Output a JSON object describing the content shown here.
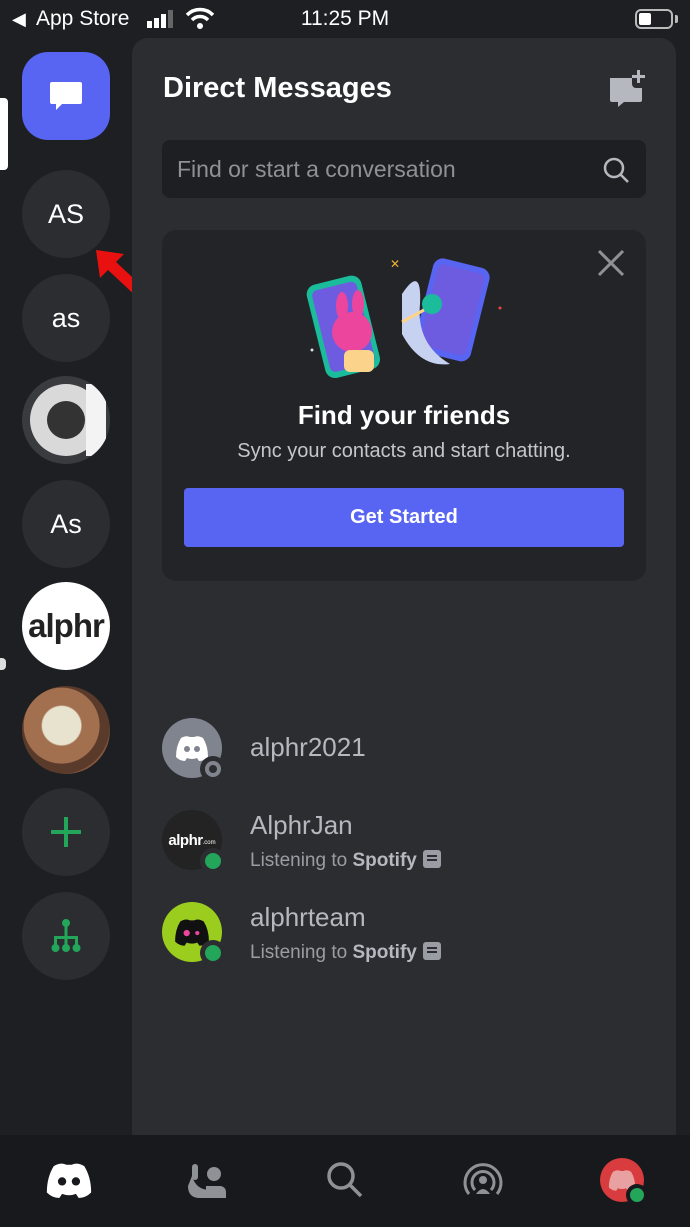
{
  "statusbar": {
    "back_label": "App Store",
    "time": "11:25 PM"
  },
  "rail": {
    "items": [
      {
        "label": "AS"
      },
      {
        "label": "as"
      },
      {
        "label": ""
      },
      {
        "label": "As"
      },
      {
        "label": "alphr"
      },
      {
        "label": ""
      },
      {
        "label": "+"
      },
      {
        "label": ""
      }
    ]
  },
  "header": {
    "title": "Direct Messages"
  },
  "search": {
    "placeholder": "Find or start a conversation"
  },
  "card": {
    "title": "Find your friends",
    "subtitle": "Sync your contacts and start chatting.",
    "button_label": "Get Started"
  },
  "dms": [
    {
      "name": "alphr2021",
      "status": "offline"
    },
    {
      "name": "AlphrJan",
      "activity_prefix": "Listening to ",
      "activity_app": "Spotify",
      "status": "online",
      "avatar_text": "alphr",
      "avatar_suffix": ".com"
    },
    {
      "name": "alphrteam",
      "activity_prefix": "Listening to ",
      "activity_app": "Spotify",
      "status": "online"
    }
  ],
  "colors": {
    "accent": "#5865f2",
    "online": "#23a55a",
    "offline": "#80848e"
  }
}
